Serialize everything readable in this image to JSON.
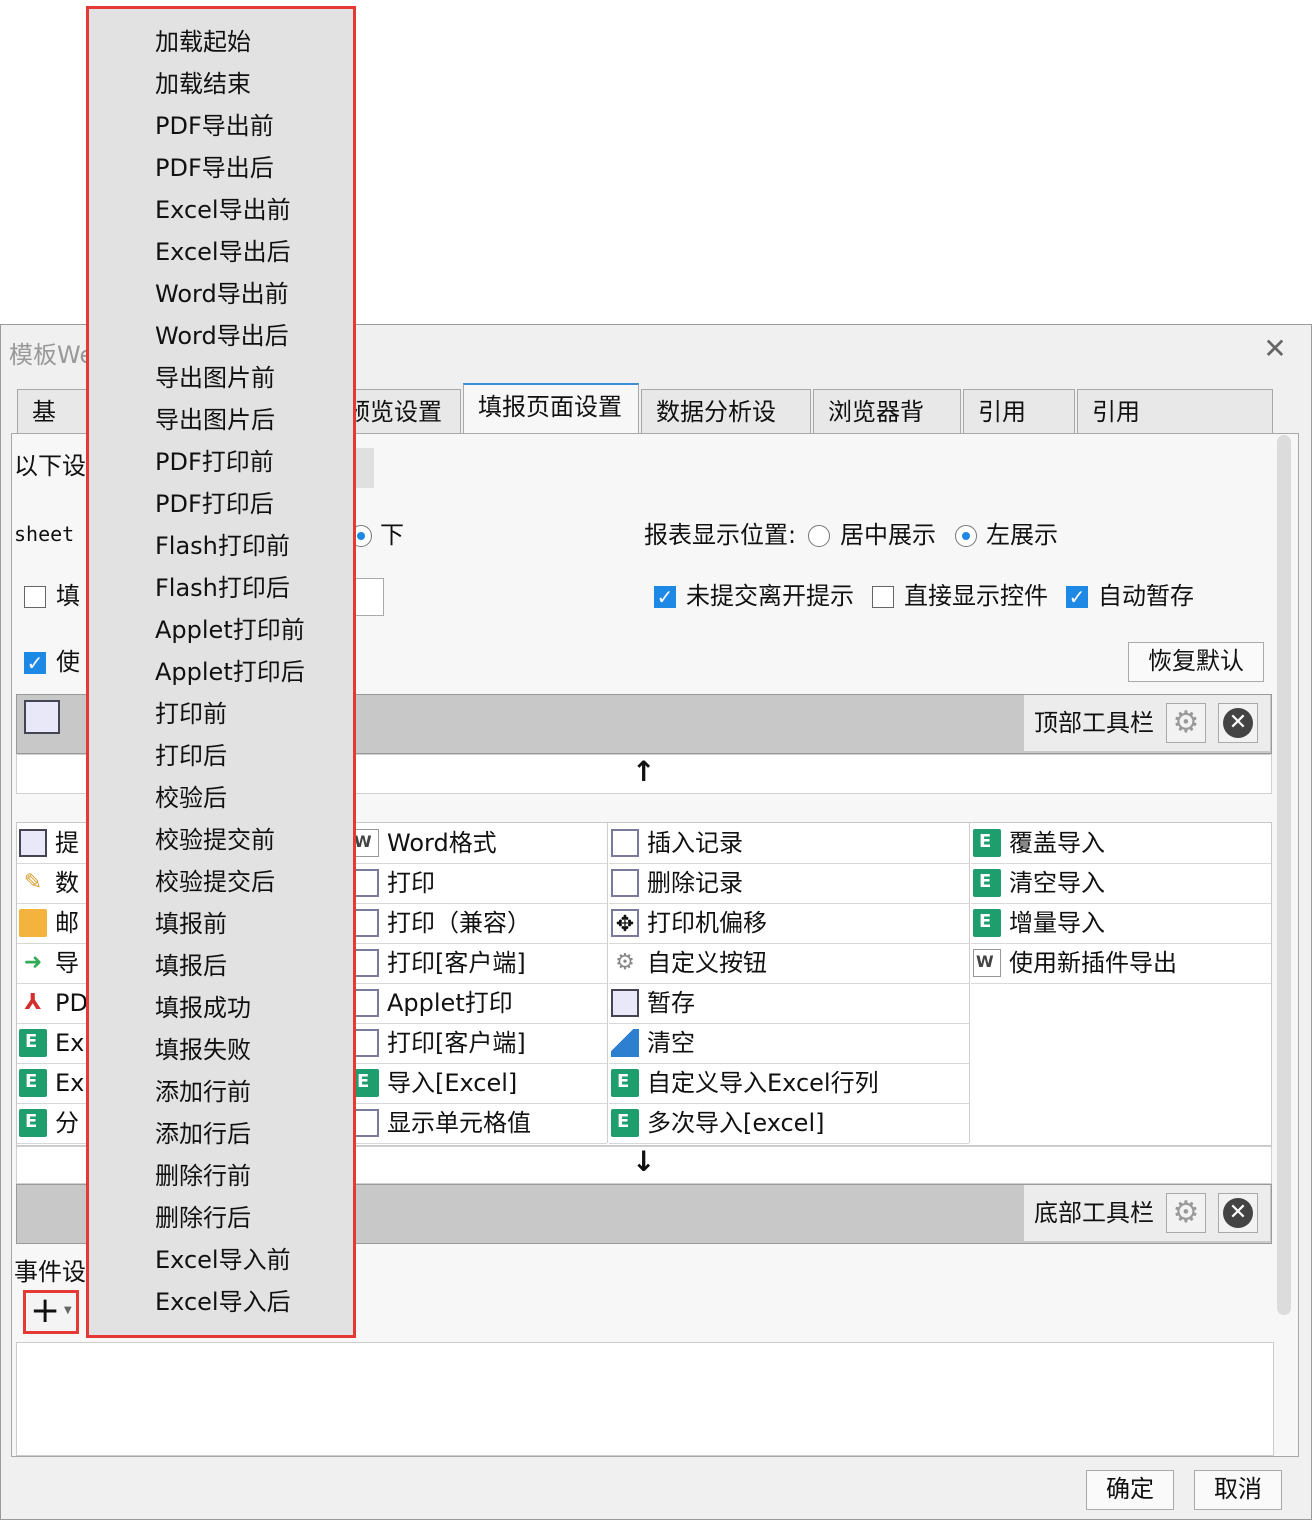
{
  "dialog": {
    "title": "模板We",
    "close_glyph": "✕",
    "tabs": [
      "基本",
      "预览设置",
      "填报页面设置",
      "数据分析设置",
      "浏览器背景",
      "引用Css",
      "引用JavaScript"
    ],
    "active_tab": "填报页面设置"
  },
  "settings": {
    "row1_label": "以下设",
    "sheet_label": "sheet",
    "sheet_opt_down": "下",
    "display_pos_label": "报表显示位置:",
    "display_center": "居中展示",
    "display_left": "左展示",
    "fill_label": "填",
    "leave_prompt": "未提交离开提示",
    "show_controls": "直接显示控件",
    "autosave": "自动暂存",
    "use_label": "使",
    "restore_default": "恢复默认"
  },
  "toolbar": {
    "top_label": "顶部工具栏",
    "bottom_label": "底部工具栏",
    "up_arrow": "↑",
    "down_arrow": "↓"
  },
  "buttons": {
    "col1": [
      {
        "text": "提",
        "icon": "save-icon"
      },
      {
        "text": "数",
        "icon": "edit-icon"
      },
      {
        "text": "邮",
        "icon": "mail-icon"
      },
      {
        "text": "导",
        "icon": "export-icon"
      },
      {
        "text": "PD",
        "icon": "pdf-icon"
      },
      {
        "text": "Ex",
        "icon": "excel-icon"
      },
      {
        "text": "Ex",
        "icon": "excel-icon"
      },
      {
        "text": "分",
        "icon": "excel-icon"
      }
    ],
    "col2": [
      {
        "text": "Word格式",
        "icon": "word-icon"
      },
      {
        "text": "打印",
        "icon": "print-icon"
      },
      {
        "text": "打印（兼容）",
        "icon": "print-icon"
      },
      {
        "text": "打印[客户端]",
        "icon": "print-icon"
      },
      {
        "text": "Applet打印",
        "icon": "print-icon"
      },
      {
        "text": "打印[客户端]",
        "icon": "print-icon"
      },
      {
        "text": "导入[Excel]",
        "icon": "excel-icon"
      },
      {
        "text": "显示单元格值",
        "icon": "cell-icon"
      }
    ],
    "col3": [
      {
        "text": "插入记录",
        "icon": "insert-record-icon"
      },
      {
        "text": "删除记录",
        "icon": "delete-record-icon"
      },
      {
        "text": "打印机偏移",
        "icon": "move-icon"
      },
      {
        "text": "自定义按钮",
        "icon": "gear-icon"
      },
      {
        "text": "暂存",
        "icon": "save-icon"
      },
      {
        "text": "清空",
        "icon": "eraser-icon"
      },
      {
        "text": "自定义导入Excel行列",
        "icon": "excel-icon"
      },
      {
        "text": "多次导入[excel]",
        "icon": "excel-icon"
      }
    ],
    "col4": [
      {
        "text": "覆盖导入",
        "icon": "excel-icon"
      },
      {
        "text": "清空导入",
        "icon": "excel-icon"
      },
      {
        "text": "增量导入",
        "icon": "excel-icon"
      },
      {
        "text": "使用新插件导出",
        "icon": "word-icon"
      }
    ]
  },
  "events": {
    "label": "事件设",
    "add_glyph": "+"
  },
  "menu": {
    "items": [
      "加载起始",
      "加载结束",
      "PDF导出前",
      "PDF导出后",
      "Excel导出前",
      "Excel导出后",
      "Word导出前",
      "Word导出后",
      "导出图片前",
      "导出图片后",
      "PDF打印前",
      "PDF打印后",
      "Flash打印前",
      "Flash打印后",
      "Applet打印前",
      "Applet打印后",
      "打印前",
      "打印后",
      "校验后",
      "校验提交前",
      "校验提交后",
      "填报前",
      "填报后",
      "填报成功",
      "填报失败",
      "添加行前",
      "添加行后",
      "删除行前",
      "删除行后",
      "Excel导入前",
      "Excel导入后"
    ]
  },
  "footer": {
    "ok": "确定",
    "cancel": "取消"
  }
}
